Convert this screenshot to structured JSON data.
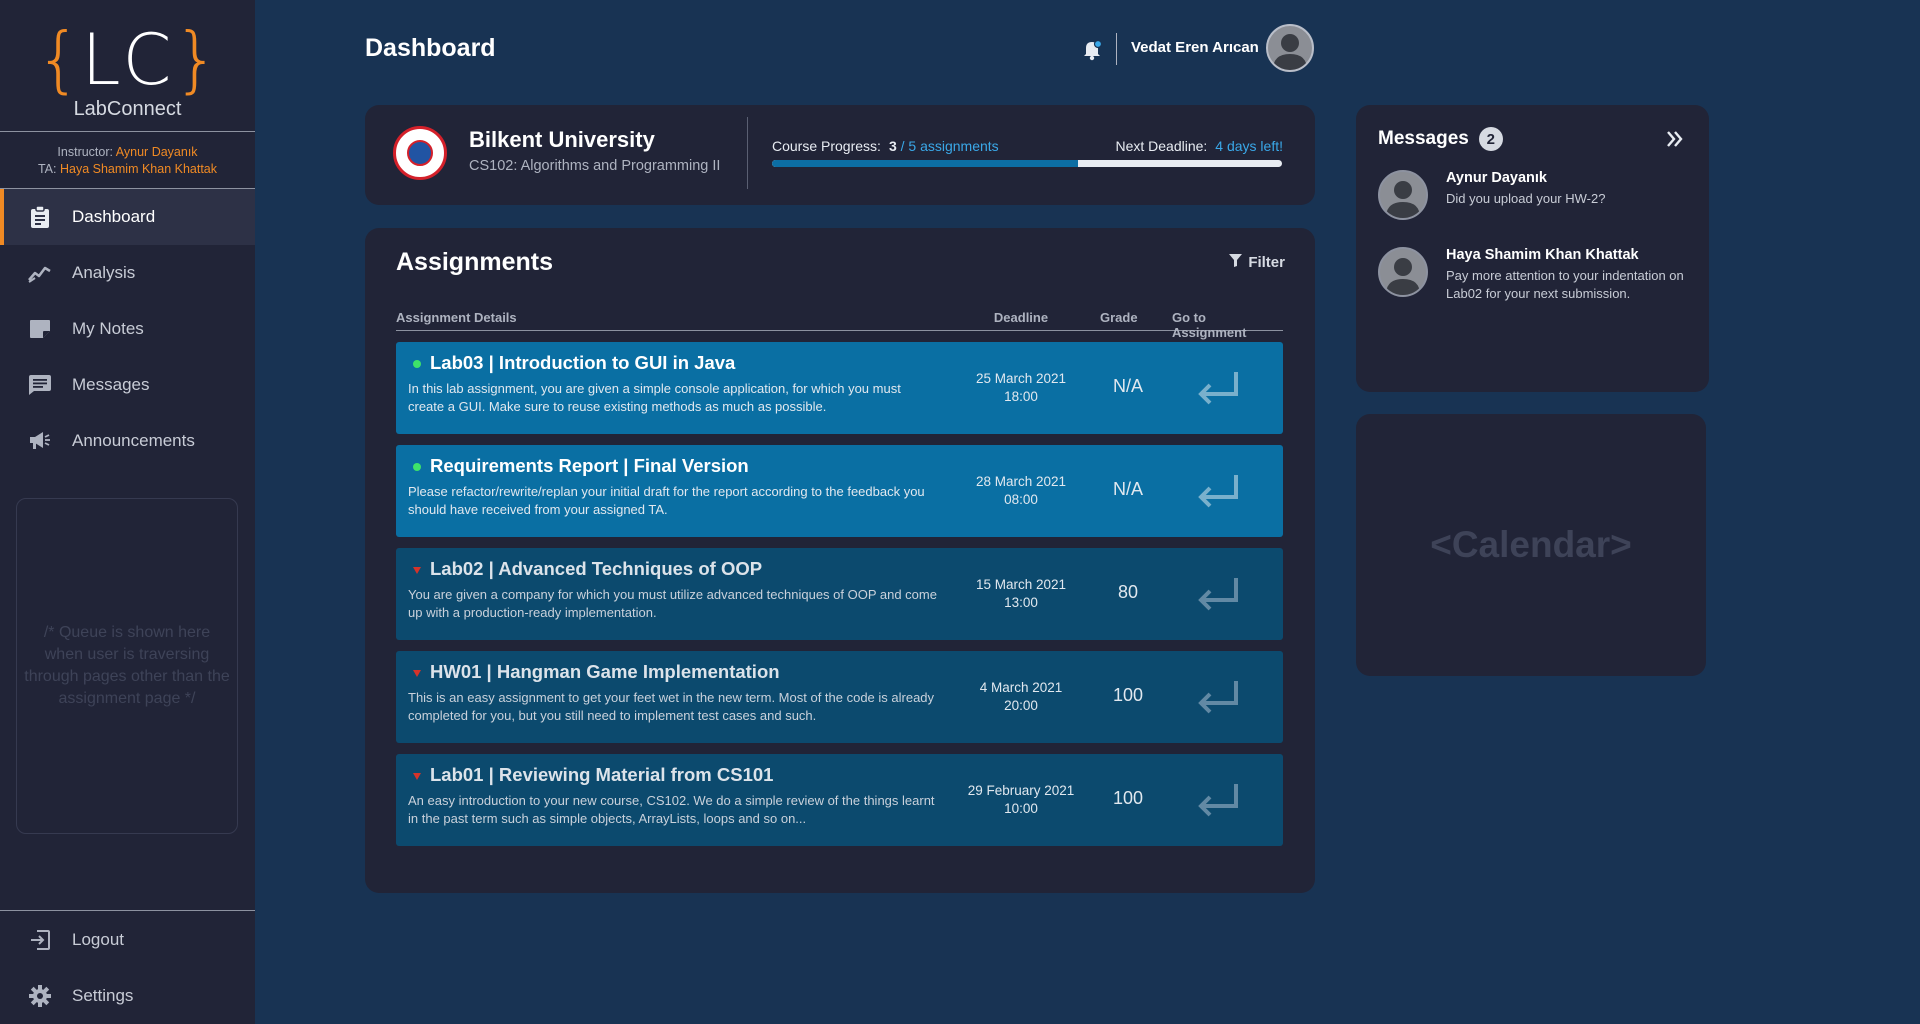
{
  "sidebar": {
    "logo": {
      "brace_open": "{",
      "letters": "LC",
      "brace_close": "}"
    },
    "app_name": "LabConnect",
    "instructor_label": "Instructor:",
    "instructor_name": "Aynur Dayanık",
    "ta_label": "TA:",
    "ta_name": "Haya Shamim Khan Khattak",
    "nav": [
      {
        "label": "Dashboard",
        "icon": "clipboard-icon",
        "active": true
      },
      {
        "label": "Analysis",
        "icon": "chart-line-icon",
        "active": false
      },
      {
        "label": "My Notes",
        "icon": "note-icon",
        "active": false
      },
      {
        "label": "Messages",
        "icon": "chat-icon",
        "active": false
      },
      {
        "label": "Announcements",
        "icon": "megaphone-icon",
        "active": false
      }
    ],
    "queue_placeholder": "/* Queue is shown here when user is traversing through pages other than the assignment page */",
    "bottom_nav": [
      {
        "label": "Logout",
        "icon": "logout-icon"
      },
      {
        "label": "Settings",
        "icon": "gear-icon"
      }
    ]
  },
  "header": {
    "title": "Dashboard",
    "user_name": "Vedat Eren Arıcan",
    "bell_icon": "bell-icon"
  },
  "course": {
    "university": "Bilkent University",
    "course_name": "CS102: Algorithms and Programming II",
    "progress_label": "Course Progress:",
    "progress_current": "3",
    "progress_total": "/ 5 assignments",
    "progress_fraction": 0.6,
    "deadline_label": "Next Deadline:",
    "deadline_value": "4 days left!"
  },
  "assignments": {
    "title": "Assignments",
    "filter_label": "Filter",
    "headers": {
      "details": "Assignment Details",
      "deadline": "Deadline",
      "grade": "Grade",
      "go": "Go to Assignment"
    },
    "rows": [
      {
        "title": "Lab03 | Introduction to GUI in Java",
        "description": "In this lab assignment, you are given a simple console application, for which you must create a GUI. Make sure to reuse existing methods as much as possible.",
        "deadline_date": "25 March 2021",
        "deadline_time": "18:00",
        "grade": "N/A",
        "status": "open"
      },
      {
        "title": "Requirements Report | Final Version",
        "description": "Please refactor/rewrite/replan your initial draft for the report according to the feedback you should have received from your assigned TA.",
        "deadline_date": "28 March 2021",
        "deadline_time": "08:00",
        "grade": "N/A",
        "status": "open"
      },
      {
        "title": "Lab02 | Advanced Techniques of OOP",
        "description": "You are given a company for which you must utilize advanced techniques of OOP and come up with a production-ready implementation.",
        "deadline_date": "15 March 2021",
        "deadline_time": "13:00",
        "grade": "80",
        "status": "closed"
      },
      {
        "title": "HW01 | Hangman Game Implementation",
        "description": "This is an easy assignment to get your feet wet in the new term. Most of the code is already completed for you, but you still need to implement test cases and such.",
        "deadline_date": "4 March 2021",
        "deadline_time": "20:00",
        "grade": "100",
        "status": "closed"
      },
      {
        "title": "Lab01 | Reviewing Material from CS101",
        "description": "An easy introduction to your new course, CS102. We do a simple review of the things learnt in the past term such as simple objects, ArrayLists, loops and so on...",
        "deadline_date": "29 February 2021",
        "deadline_time": "10:00",
        "grade": "100",
        "status": "closed"
      }
    ]
  },
  "messages": {
    "title": "Messages",
    "count": "2",
    "items": [
      {
        "sender": "Aynur Dayanık",
        "text": "Did you upload  your  HW-2?"
      },
      {
        "sender": "Haya Shamim Khan Khattak",
        "text": "Pay more attention to your indentation on Lab02 for your next submission."
      }
    ]
  },
  "calendar": {
    "placeholder": "<Calendar>"
  },
  "colors": {
    "background": "#183353",
    "panel": "#212437",
    "accent_orange": "#f08a24",
    "accent_blue": "#3aa8e8",
    "row_open": "#0a6fa3",
    "row_closed": "#0c4a6e",
    "status_open": "#3ee26a",
    "status_closed": "#d5332a"
  }
}
